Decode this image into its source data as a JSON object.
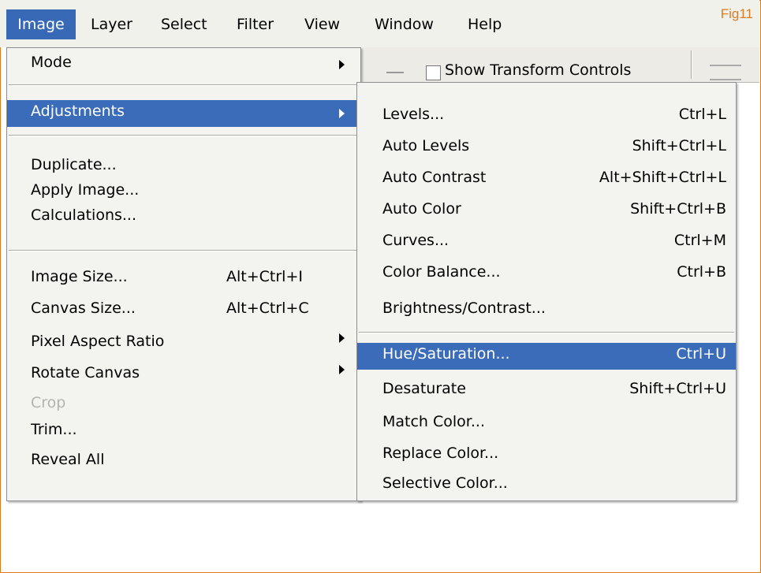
{
  "figure_label": "Fig11",
  "menubar": {
    "items": [
      "Image",
      "Layer",
      "Select",
      "Filter",
      "View",
      "Window",
      "Help"
    ],
    "active_index": 0
  },
  "toolbar": {
    "show_transform_controls": "Show Transform Controls",
    "checked": false
  },
  "image_menu": {
    "items": [
      {
        "label": "Mode",
        "submenu": true
      },
      {
        "label": "Adjustments",
        "submenu": true,
        "highlighted": true
      },
      {
        "label": "Duplicate..."
      },
      {
        "label": "Apply Image..."
      },
      {
        "label": "Calculations..."
      },
      {
        "label": "Image Size...",
        "shortcut": "Alt+Ctrl+I"
      },
      {
        "label": "Canvas Size...",
        "shortcut": "Alt+Ctrl+C"
      },
      {
        "label": "Pixel Aspect Ratio",
        "submenu": true
      },
      {
        "label": "Rotate Canvas",
        "submenu": true
      },
      {
        "label": "Crop",
        "disabled": true
      },
      {
        "label": "Trim..."
      },
      {
        "label": "Reveal All"
      }
    ]
  },
  "adjustments_submenu": {
    "items": [
      {
        "label": "Levels...",
        "shortcut": "Ctrl+L"
      },
      {
        "label": "Auto Levels",
        "shortcut": "Shift+Ctrl+L"
      },
      {
        "label": "Auto Contrast",
        "shortcut": "Alt+Shift+Ctrl+L"
      },
      {
        "label": "Auto Color",
        "shortcut": "Shift+Ctrl+B"
      },
      {
        "label": "Curves...",
        "shortcut": "Ctrl+M"
      },
      {
        "label": "Color Balance...",
        "shortcut": "Ctrl+B"
      },
      {
        "label": "Brightness/Contrast..."
      },
      {
        "label": "Hue/Saturation...",
        "shortcut": "Ctrl+U",
        "highlighted": true
      },
      {
        "label": "Desaturate",
        "shortcut": "Shift+Ctrl+U"
      },
      {
        "label": "Match Color..."
      },
      {
        "label": "Replace Color..."
      },
      {
        "label": "Selective Color..."
      }
    ]
  },
  "colors": {
    "highlight": "#3b6cb9",
    "frame": "#e07a1f",
    "menu_bg": "#f3f3ef"
  }
}
